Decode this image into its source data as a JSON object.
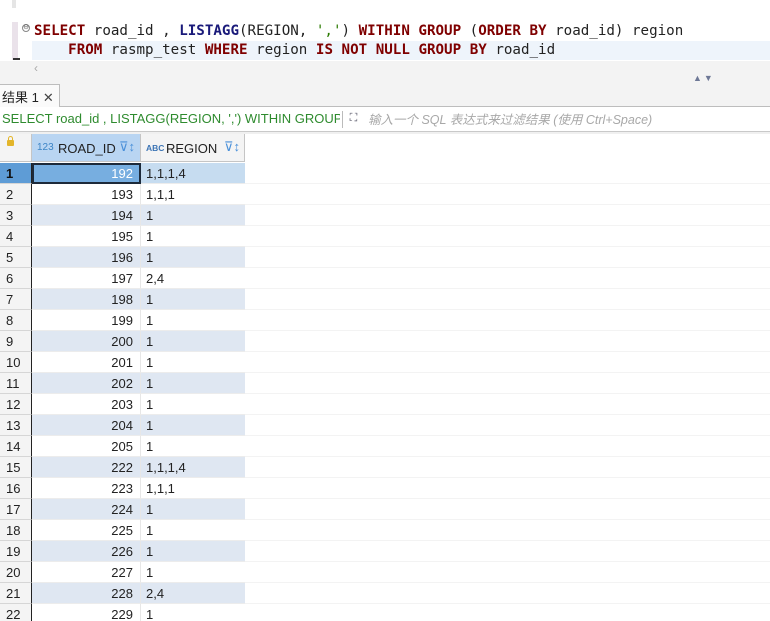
{
  "editor": {
    "line1": {
      "t1": "SELECT",
      "t2": " road_id , ",
      "t3": "LISTAGG",
      "t4": "(REGION, ",
      "t5": "','",
      "t6": ") ",
      "t7": "WITHIN",
      "t8": " ",
      "t9": "GROUP",
      "t10": " (",
      "t11": "ORDER",
      "t12": " ",
      "t13": "BY",
      "t14": " road_id) region"
    },
    "line2": {
      "t1": "    ",
      "t2": "FROM",
      "t3": " rasmp_test ",
      "t4": "WHERE",
      "t5": " region ",
      "t6": "IS",
      "t7": " ",
      "t8": "NOT",
      "t9": " ",
      "t10": "NULL",
      "t11": " ",
      "t12": "GROUP",
      "t13": " ",
      "t14": "BY",
      "t15": " road_id"
    },
    "scroll_left_icon": "‹",
    "nav_up_down": "▲▼",
    "fold_icon": "⊖"
  },
  "tabs": [
    {
      "label": "结果 1",
      "close": "✕"
    }
  ],
  "filter": {
    "query_text": "SELECT road_id , LISTAGG(REGION, ',') WITHIN GROUP (ORDER BY road_id) region FROM rasmp_test WHERE region IS NOT NULL GROUP BY road_id",
    "expand_icon": "⛶",
    "placeholder": "输入一个 SQL 表达式来过滤结果 (使用 Ctrl+Space)"
  },
  "grid": {
    "columns": [
      {
        "type_badge": "123",
        "name": "ROAD_ID",
        "sort_icon": "⊽↕"
      },
      {
        "type_badge": "ABC",
        "name": "REGION",
        "sort_icon": "⊽↕"
      }
    ],
    "rows": [
      {
        "n": "1",
        "road_id": "192",
        "region": "1,1,1,4"
      },
      {
        "n": "2",
        "road_id": "193",
        "region": "1,1,1"
      },
      {
        "n": "3",
        "road_id": "194",
        "region": "1"
      },
      {
        "n": "4",
        "road_id": "195",
        "region": "1"
      },
      {
        "n": "5",
        "road_id": "196",
        "region": "1"
      },
      {
        "n": "6",
        "road_id": "197",
        "region": "2,4"
      },
      {
        "n": "7",
        "road_id": "198",
        "region": "1"
      },
      {
        "n": "8",
        "road_id": "199",
        "region": "1"
      },
      {
        "n": "9",
        "road_id": "200",
        "region": "1"
      },
      {
        "n": "10",
        "road_id": "201",
        "region": "1"
      },
      {
        "n": "11",
        "road_id": "202",
        "region": "1"
      },
      {
        "n": "12",
        "road_id": "203",
        "region": "1"
      },
      {
        "n": "13",
        "road_id": "204",
        "region": "1"
      },
      {
        "n": "14",
        "road_id": "205",
        "region": "1"
      },
      {
        "n": "15",
        "road_id": "222",
        "region": "1,1,1,4"
      },
      {
        "n": "16",
        "road_id": "223",
        "region": "1,1,1"
      },
      {
        "n": "17",
        "road_id": "224",
        "region": "1"
      },
      {
        "n": "18",
        "road_id": "225",
        "region": "1"
      },
      {
        "n": "19",
        "road_id": "226",
        "region": "1"
      },
      {
        "n": "20",
        "road_id": "227",
        "region": "1"
      },
      {
        "n": "21",
        "road_id": "228",
        "region": "2,4"
      },
      {
        "n": "22",
        "road_id": "229",
        "region": "1"
      }
    ],
    "selected_row": 1
  }
}
